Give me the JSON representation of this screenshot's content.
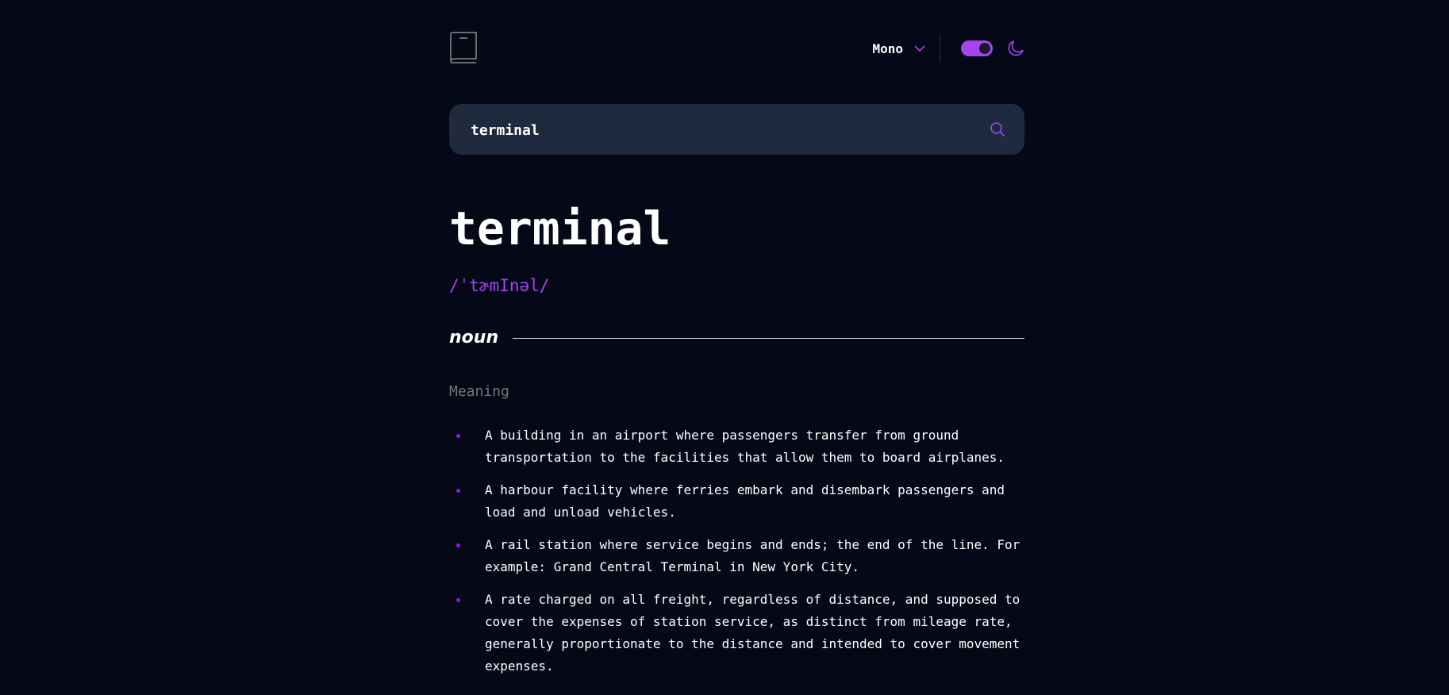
{
  "header": {
    "logo_icon": "book-icon",
    "font_selector": {
      "selected": "Mono",
      "icon": "chevron-down-icon"
    },
    "theme_toggle": {
      "state": "dark",
      "icon": "moon-icon"
    }
  },
  "search": {
    "value": "terminal",
    "icon": "search-icon"
  },
  "entry": {
    "word": "terminal",
    "phonetic": "/ˈtɚmInəl/",
    "part_of_speech": "noun",
    "meaning_heading": "Meaning",
    "definitions": [
      "A building in an airport where passengers transfer from ground transportation to the facilities that allow them to board airplanes.",
      "A harbour facility where ferries embark and disembark passengers and load and unload vehicles.",
      "A rail station where service begins and ends; the end of the line. For example: Grand Central Terminal in New York City.",
      "A rate charged on all freight, regardless of distance, and supposed to cover the expenses of station service, as distinct from mileage rate, generally proportionate to the distance and intended to cover movement expenses."
    ]
  },
  "colors": {
    "background": "#050816",
    "accent": "#a445ed",
    "search_bg": "#1f2a3e",
    "muted": "#757575"
  }
}
